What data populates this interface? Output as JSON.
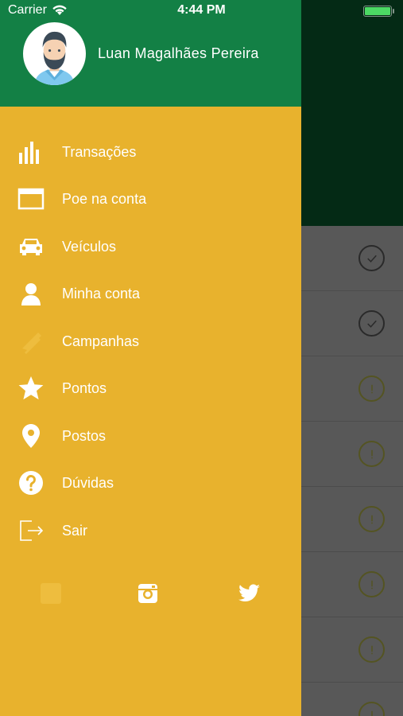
{
  "status_bar": {
    "carrier": "Carrier",
    "time": "4:44 PM"
  },
  "drawer": {
    "user_name": "Luan Magalhães Pereira",
    "menu": [
      {
        "label": "Transações",
        "icon": "bar-chart-icon"
      },
      {
        "label": "Poe na conta",
        "icon": "window-icon"
      },
      {
        "label": "Veículos",
        "icon": "car-icon"
      },
      {
        "label": "Minha conta",
        "icon": "person-icon"
      },
      {
        "label": "Campanhas",
        "icon": "ticket-icon"
      },
      {
        "label": "Pontos",
        "icon": "star-icon"
      },
      {
        "label": "Postos",
        "icon": "location-pin-icon"
      },
      {
        "label": "Dúvidas",
        "icon": "question-icon"
      },
      {
        "label": "Sair",
        "icon": "logout-icon"
      }
    ],
    "social": [
      "facebook-icon",
      "instagram-icon",
      "twitter-icon"
    ]
  },
  "colors": {
    "drawer_header": "#138045",
    "drawer_body": "#e8b22d",
    "background_header": "#042a15",
    "background_list": "#585858"
  },
  "background_list": {
    "row_status_icons": [
      "check-icon",
      "check-icon",
      "info-icon",
      "info-icon",
      "info-icon",
      "info-icon",
      "info-icon",
      "info-icon"
    ]
  }
}
